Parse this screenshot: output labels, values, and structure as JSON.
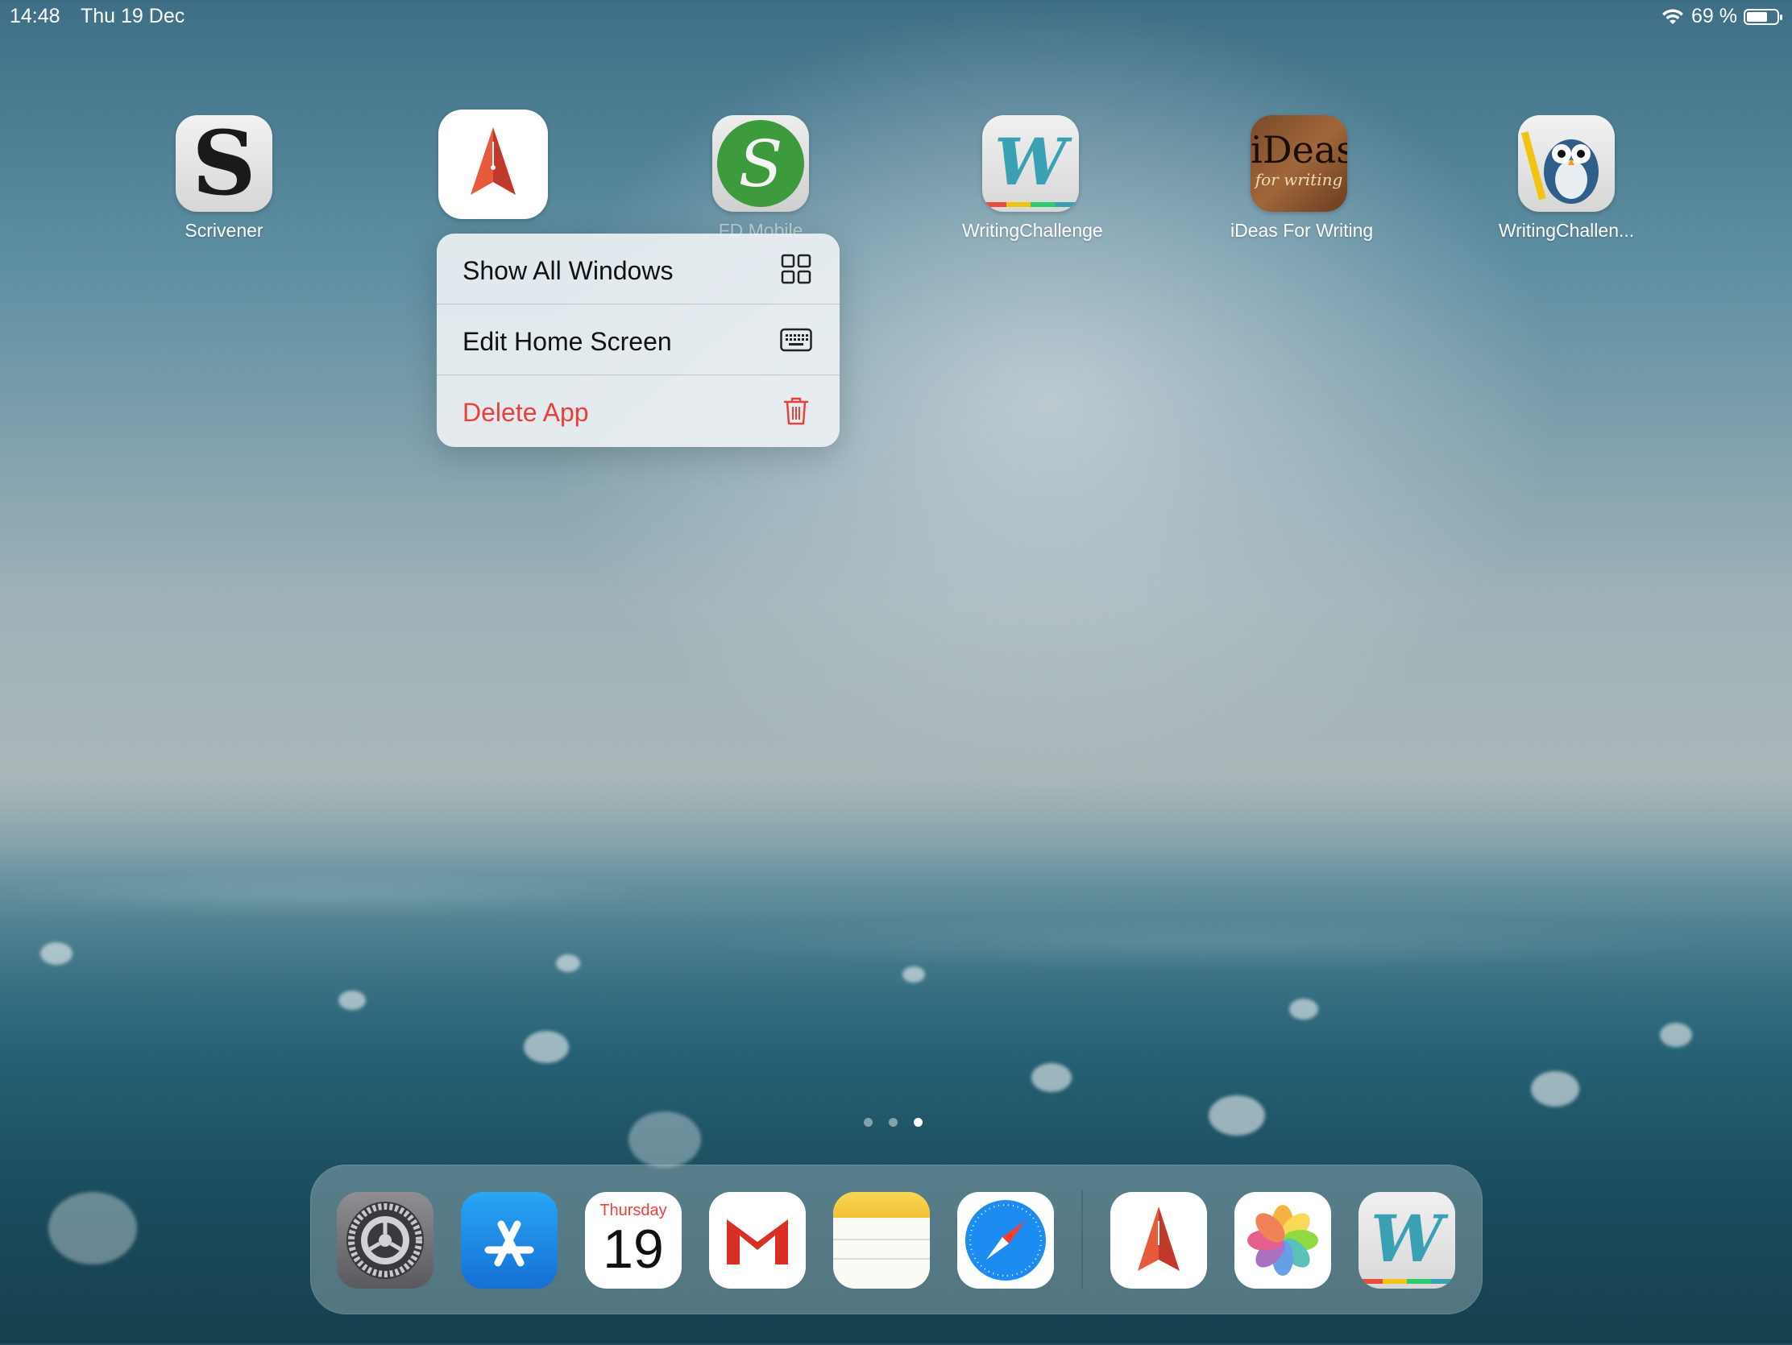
{
  "status_bar": {
    "time": "14:48",
    "date": "Thu 19 Dec",
    "battery_text": "69 %",
    "battery_level": 0.69
  },
  "home_apps": [
    {
      "label": "Scrivener",
      "icon": "scrivener-icon"
    },
    {
      "label": "",
      "icon": "compass-needle-icon"
    },
    {
      "label": "FD Mobile",
      "icon": "fd-mobile-icon"
    },
    {
      "label": "WritingChallenge",
      "icon": "writing-challenge-icon"
    },
    {
      "label": "iDeas For Writing",
      "icon": "ideas-for-writing-icon"
    },
    {
      "label": "WritingChallen...",
      "icon": "owl-icon"
    }
  ],
  "context_menu": {
    "items": [
      {
        "label": "Show All Windows",
        "icon": "grid-icon"
      },
      {
        "label": "Edit Home Screen",
        "icon": "keyboard-icon"
      },
      {
        "label": "Delete App",
        "icon": "trash-icon",
        "color": "#e8413a"
      }
    ]
  },
  "ideas_icon_text": {
    "line1": "iDeas",
    "line2": "for writing"
  },
  "page_dots": {
    "count": 3,
    "active_index": 2
  },
  "dock": {
    "calendar": {
      "weekday": "Thursday",
      "day": "19"
    },
    "apps": [
      "settings-icon",
      "app-store-icon",
      "calendar-icon",
      "gmail-icon",
      "notes-icon",
      "safari-icon",
      "compass-needle-icon",
      "photos-icon",
      "writing-challenge-icon"
    ]
  }
}
